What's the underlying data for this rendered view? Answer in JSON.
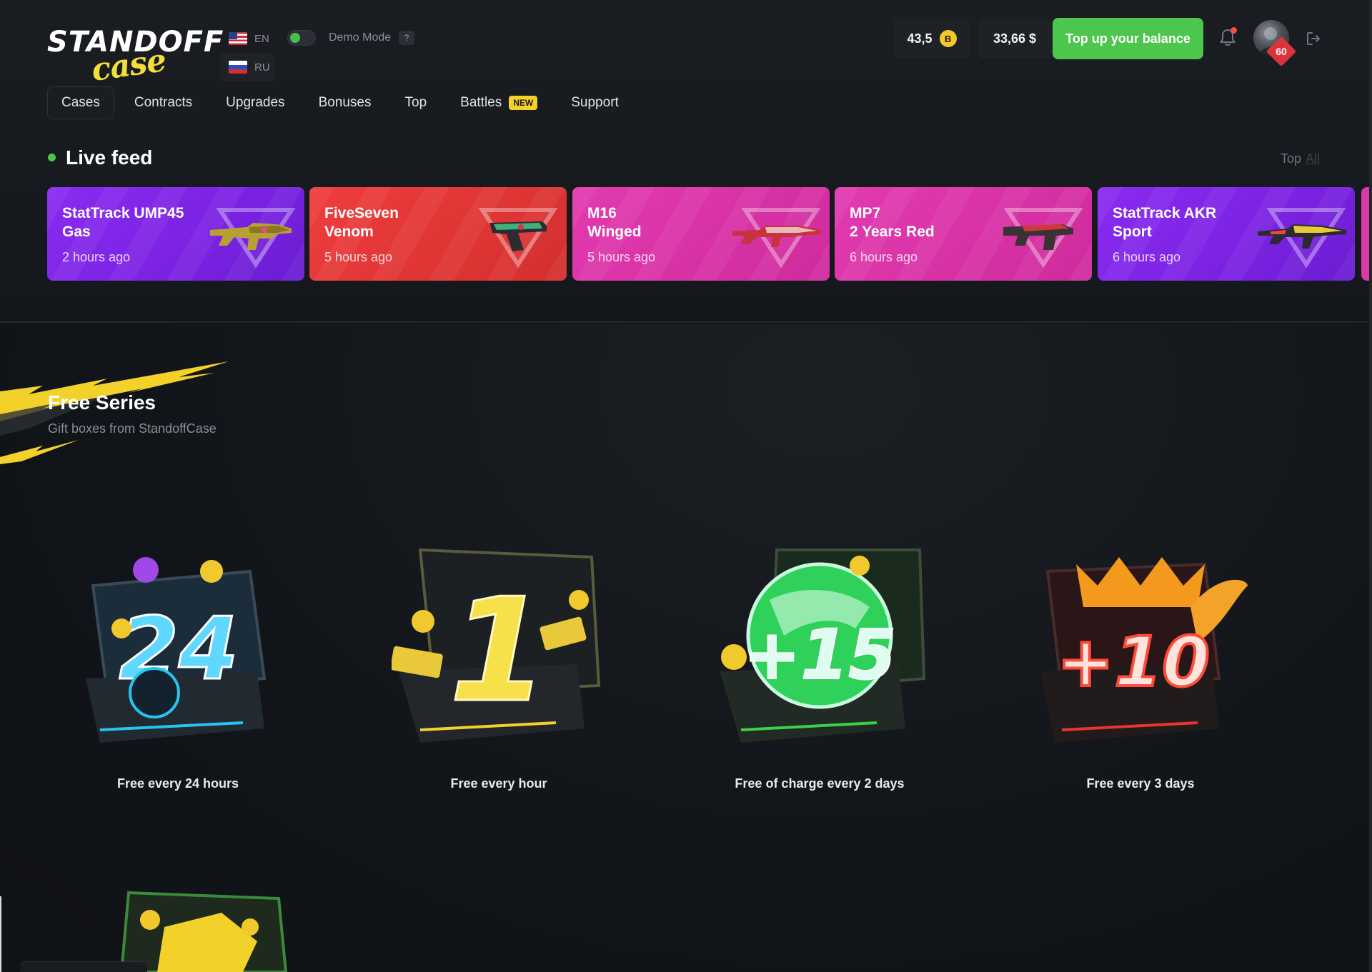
{
  "header": {
    "logo_top": "STANDOFF",
    "logo_bottom": "case",
    "languages": [
      {
        "code": "EN",
        "flag": "us-flag"
      },
      {
        "code": "RU",
        "flag": "ru-flag"
      }
    ],
    "demo_mode_label": "Demo Mode",
    "demo_help": "?",
    "coin_balance": "43,5",
    "coin_symbol": "B",
    "cash_balance": "33,66 $",
    "topup_label": "Top up your balance",
    "level": "60"
  },
  "nav": {
    "items": [
      {
        "label": "Cases"
      },
      {
        "label": "Contracts"
      },
      {
        "label": "Upgrades"
      },
      {
        "label": "Bonuses"
      },
      {
        "label": "Top"
      },
      {
        "label": "Battles",
        "badge": "NEW"
      },
      {
        "label": "Support"
      }
    ]
  },
  "live_feed": {
    "title": "Live feed",
    "tab_top": "Top",
    "tab_all": "All",
    "items": [
      {
        "name": "StatTrack UMP45\nGas",
        "time": "2 hours ago",
        "rarity": "purple"
      },
      {
        "name": "FiveSeven\nVenom",
        "time": "5 hours ago",
        "rarity": "red"
      },
      {
        "name": "M16\nWinged",
        "time": "5 hours ago",
        "rarity": "pink"
      },
      {
        "name": "MP7\n2 Years Red",
        "time": "6 hours ago",
        "rarity": "pink"
      },
      {
        "name": "StatTrack AKR\nSport",
        "time": "6 hours ago",
        "rarity": "purple"
      }
    ]
  },
  "free_series": {
    "title": "Free Series",
    "subtitle": "Gift boxes from StandoffCase",
    "cases": [
      {
        "label": "Free every 24 hours",
        "badge": "24",
        "color": "#29c3f0"
      },
      {
        "label": "Free every hour",
        "badge": "1",
        "color": "#f2d22a"
      },
      {
        "label": "Free of charge every 2 days",
        "badge": "+15",
        "color": "#3ccf4a"
      },
      {
        "label": "Free every 3 days",
        "badge": "+10",
        "color": "#e8352e"
      }
    ]
  },
  "colors": {
    "accent_green": "#4cc64c",
    "badge_yellow": "#f4d228",
    "rarity_purple": "#8a2bf0",
    "rarity_red": "#ef3d3d",
    "rarity_pink": "#e23bb0"
  }
}
